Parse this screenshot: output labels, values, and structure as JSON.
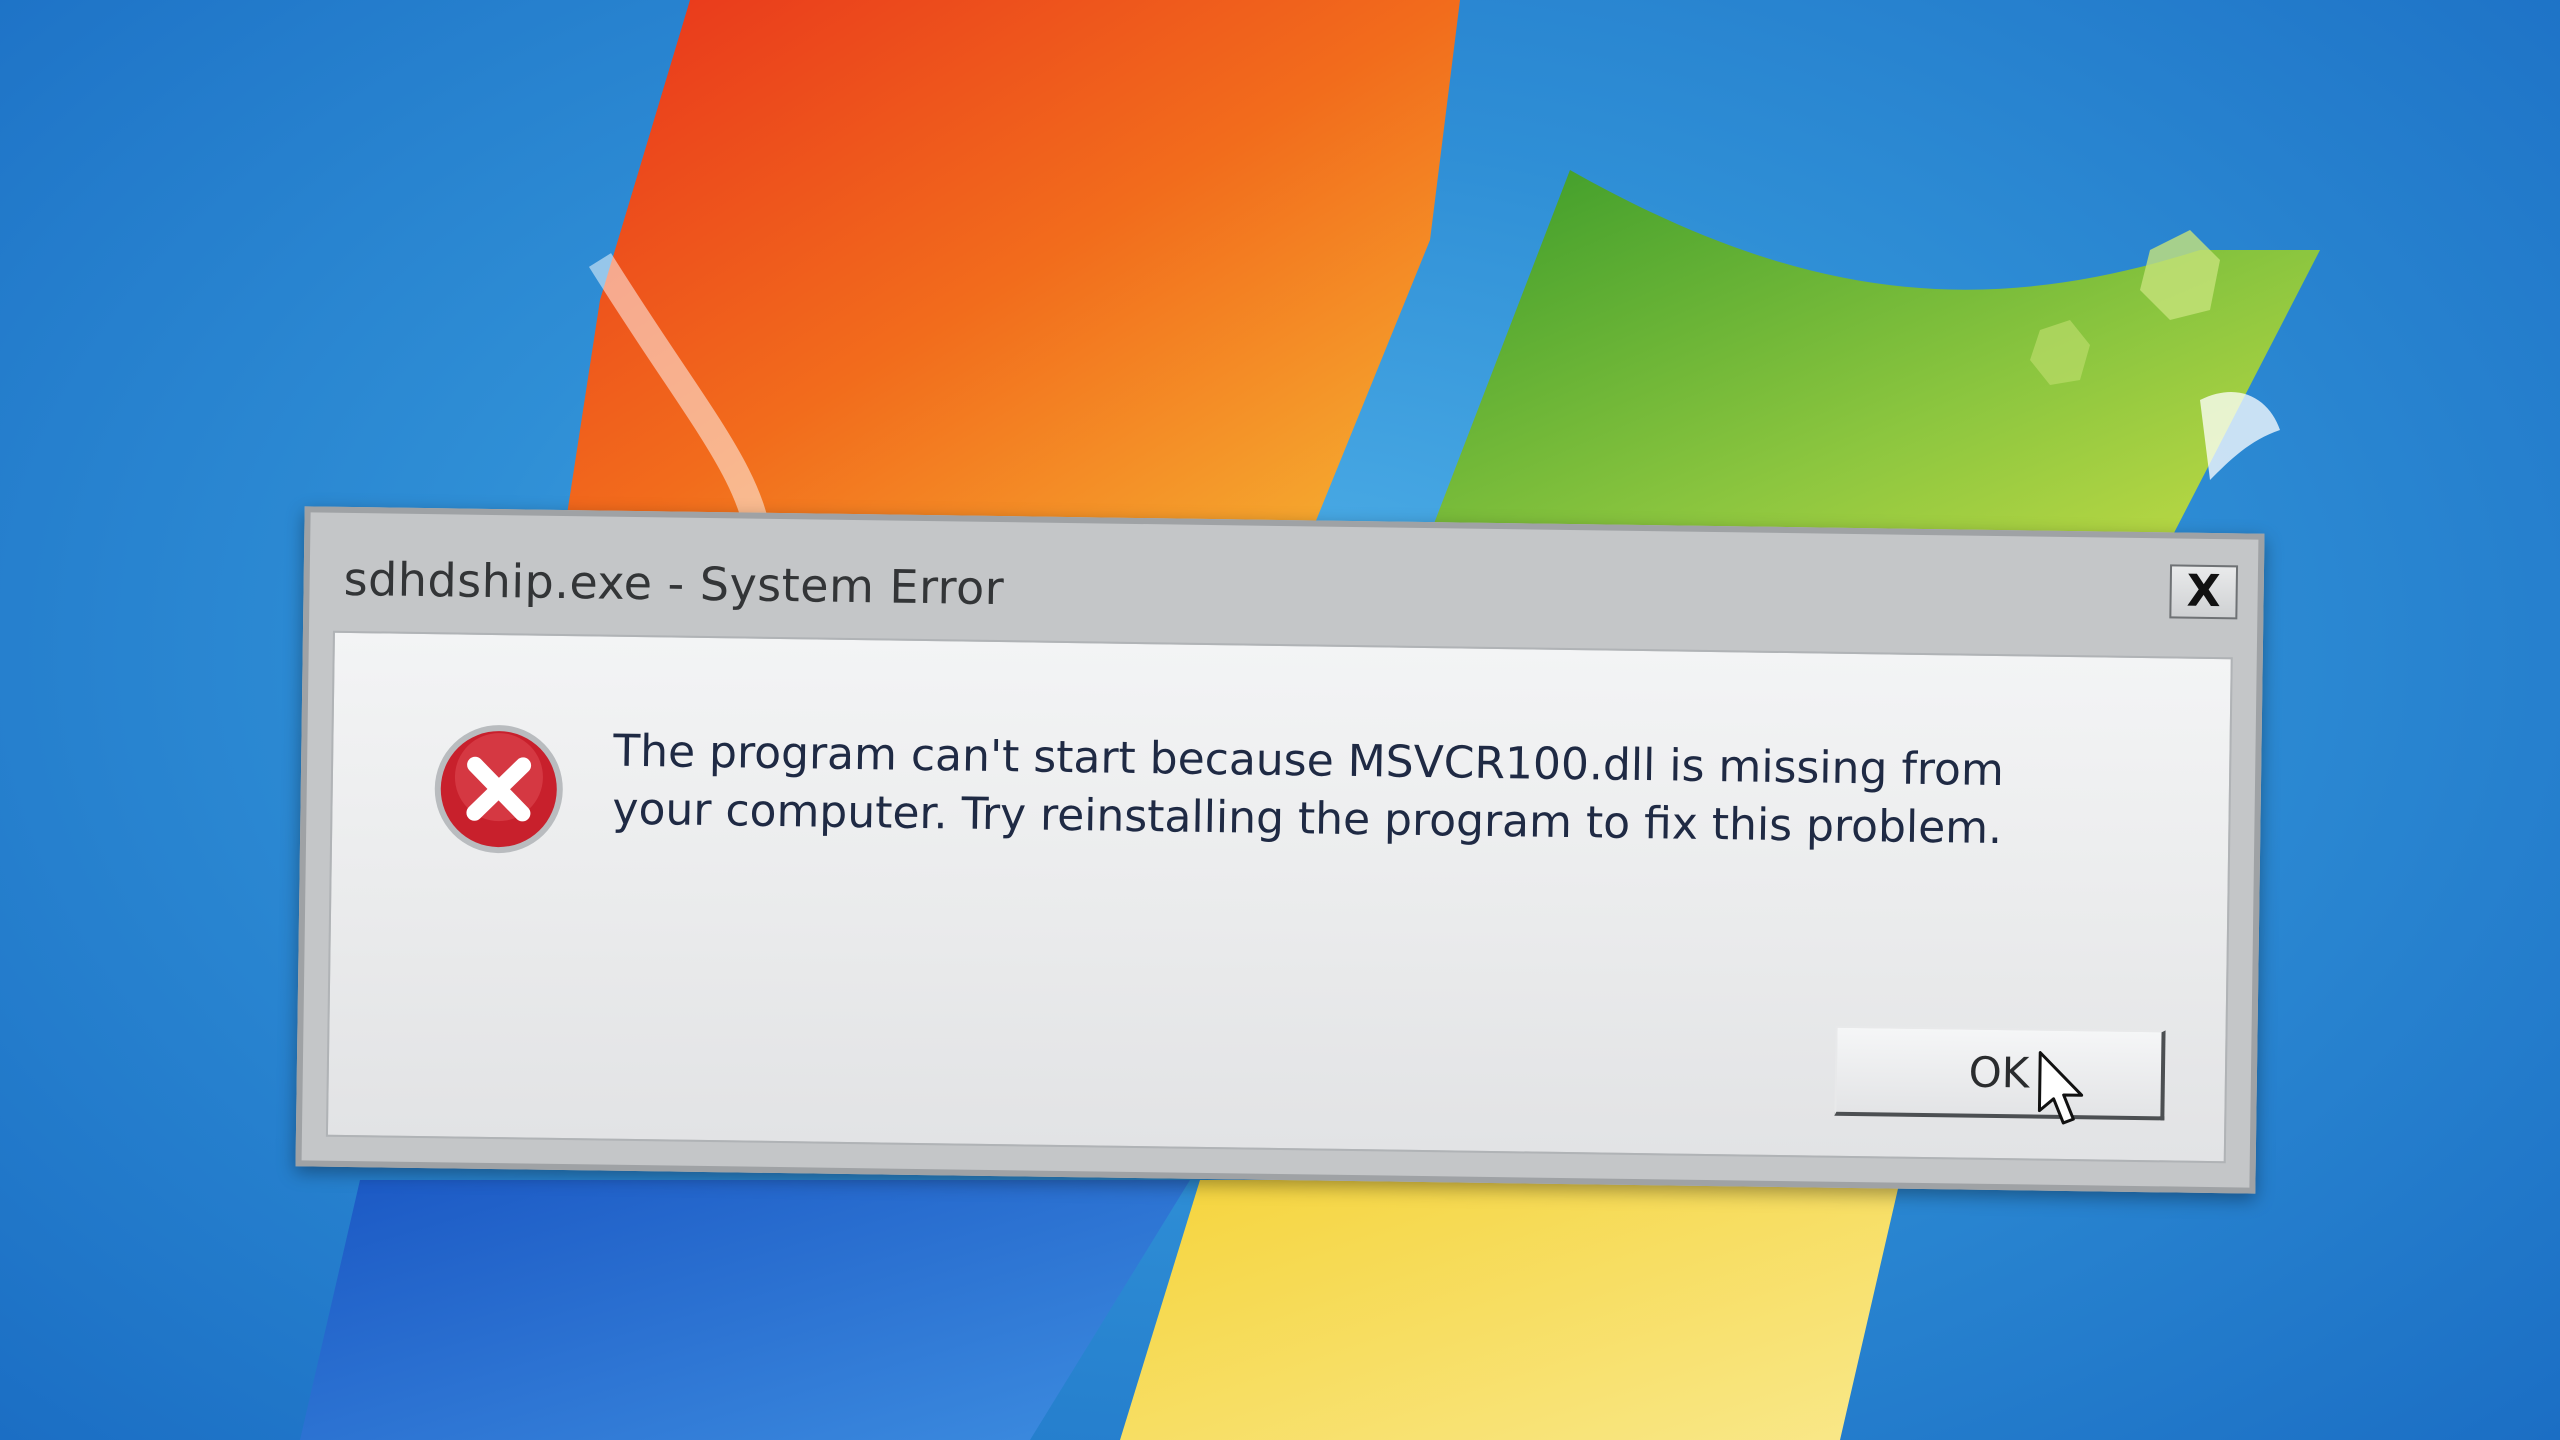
{
  "dialog": {
    "title": "sdhdship.exe - System Error",
    "close_glyph": "X",
    "message": "The program can't start because MSVCR100.dll is missing from your computer. Try reinstalling the program to fix this problem.",
    "ok_label": "OK",
    "icon": "error-icon"
  },
  "colors": {
    "error_red": "#c8202c",
    "desktop_blue": "#2f8fd6",
    "dialog_frame": "#c4c6c8"
  }
}
